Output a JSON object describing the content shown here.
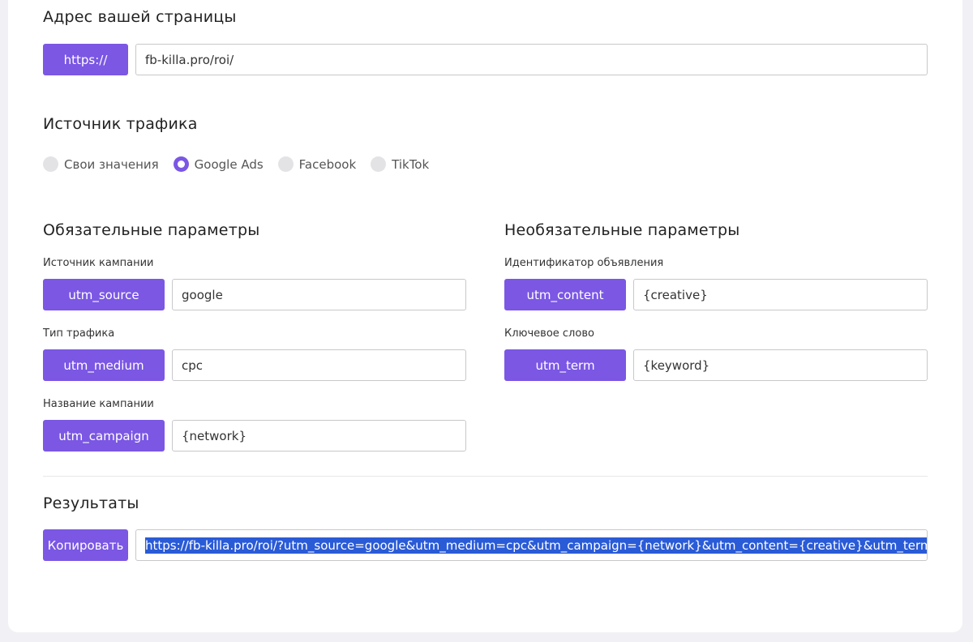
{
  "address": {
    "title": "Адрес вашей страницы",
    "protocol_label": "https://",
    "url_value": "fb-killa.pro/roi/"
  },
  "traffic": {
    "title": "Источник трафика",
    "options": [
      {
        "label": "Свои значения",
        "checked": false
      },
      {
        "label": "Google Ads",
        "checked": true
      },
      {
        "label": "Facebook",
        "checked": false
      },
      {
        "label": "TikTok",
        "checked": false
      }
    ]
  },
  "required": {
    "title": "Обязательные параметры",
    "fields": [
      {
        "label": "Источник кампании",
        "param": "utm_source",
        "value": "google"
      },
      {
        "label": "Тип трафика",
        "param": "utm_medium",
        "value": "cpc"
      },
      {
        "label": "Название кампании",
        "param": "utm_campaign",
        "value": "{network}"
      }
    ]
  },
  "optional": {
    "title": "Необязательные параметры",
    "fields": [
      {
        "label": "Идентификатор объявления",
        "param": "utm_content",
        "value": "{creative}"
      },
      {
        "label": "Ключевое слово",
        "param": "utm_term",
        "value": "{keyword}"
      }
    ]
  },
  "results": {
    "title": "Результаты",
    "copy_label": "Копировать",
    "url": "https://fb-killa.pro/roi/?utm_source=google&utm_medium=cpc&utm_campaign={network}&utm_content={creative}&utm_term={keywor"
  },
  "colors": {
    "accent": "#7b57e4",
    "selection": "#2a5bd7"
  }
}
